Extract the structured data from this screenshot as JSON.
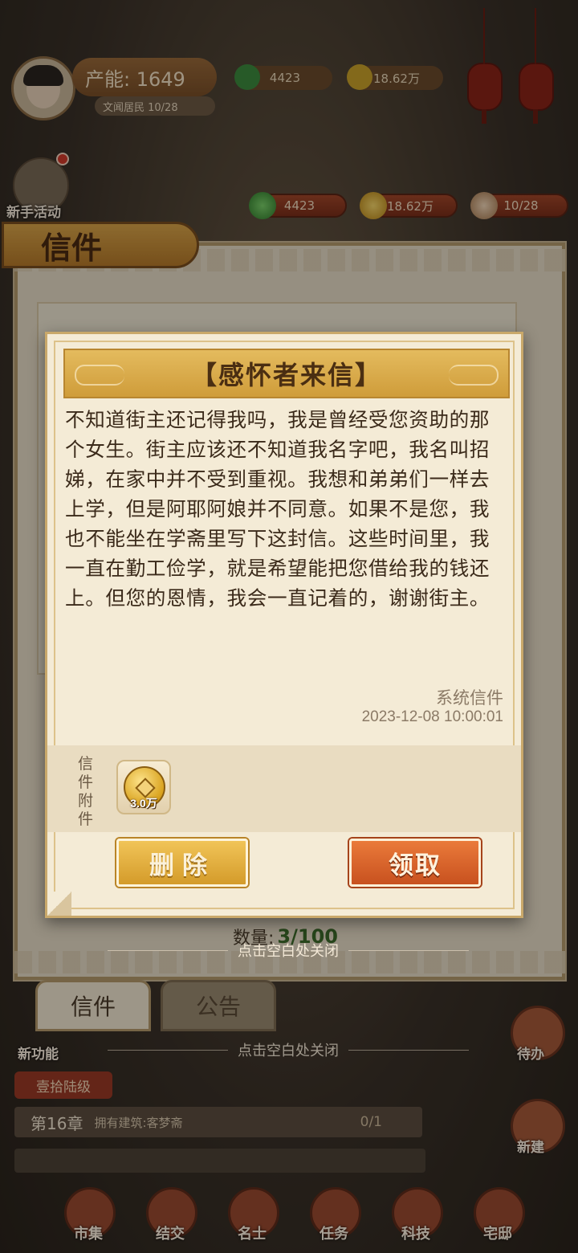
{
  "hud": {
    "capacity": "产能: 1649",
    "resident": "文闻居民 10/28",
    "top_jade": "4423",
    "top_coins": "18.62万",
    "event_label": "新手活动"
  },
  "resources": {
    "jade": "4423",
    "coins": "18.62万",
    "residents": "10/28"
  },
  "mail_panel": {
    "title": "信件",
    "count_label": "数量:",
    "count_value": "3/100",
    "tabs": [
      "信件",
      "公告"
    ]
  },
  "letter": {
    "title": "【感怀者来信】",
    "body": "不知道街主还记得我吗，我是曾经受您资助的那个女生。街主应该还不知道我名字吧，我名叫招娣，在家中并不受到重视。我想和弟弟们一样去上学，但是阿耶阿娘并不同意。如果不是您，我也不能坐在学斋里写下这封信。这些时间里，我一直在勤工俭学，就是希望能把您借给我的钱还上。但您的恩情，我会一直记着的，谢谢街主。",
    "sender": "系统信件",
    "date": "2023-12-08  10:00:01",
    "attachment_label": "信件附件",
    "attachment_amount": "3.0万",
    "delete_label": "删除",
    "claim_label": "领取"
  },
  "close_hint": "点击空白处关闭",
  "bottom": {
    "new_feature": "新功能",
    "rank": "壹拾陆级",
    "chapter": "第16章",
    "task": "拥有建筑:客梦斋",
    "task_progress": "0/1",
    "side_todo": "待办",
    "side_build": "新建",
    "nav": [
      "市集",
      "结交",
      "名士",
      "任务",
      "科技",
      "宅邸"
    ]
  },
  "colors": {
    "parchment": "#f4ebd6",
    "header_gold": "#d9aa4a",
    "delete_button": "#e0ad3e",
    "claim_button": "#d9622a",
    "panel_bg": "#e7dcc6"
  },
  "icons": {
    "jade": "jade-icon",
    "coin": "coin-icon",
    "resident": "resident-icon",
    "attachment": "copper-coin-icon"
  }
}
